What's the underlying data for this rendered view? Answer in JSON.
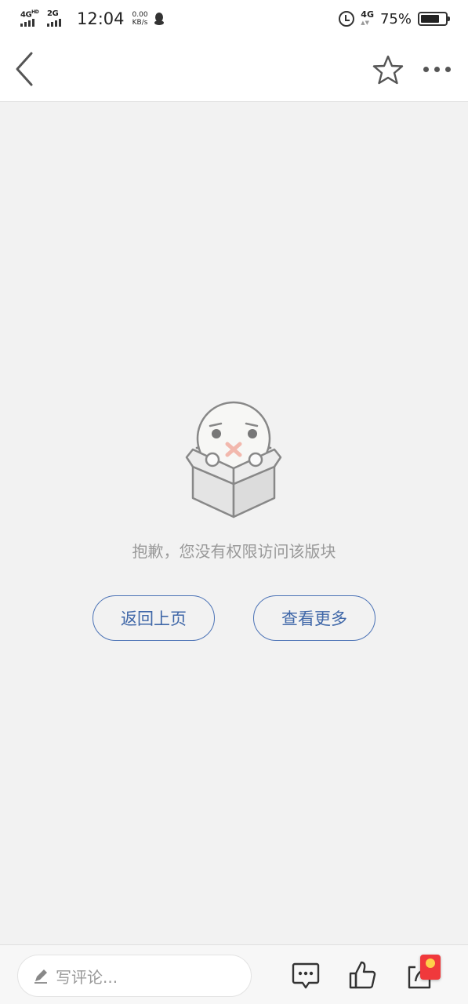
{
  "status_bar": {
    "sim1": "4G",
    "sim1_sup": "HD",
    "sim2": "2G",
    "time": "12:04",
    "speed_value": "0.00",
    "speed_unit": "KB/s",
    "network": "4G",
    "battery": "75%",
    "battery_level": 0.75,
    "icons": [
      "signal-icon",
      "qq-icon",
      "alarm-icon",
      "battery-icon"
    ]
  },
  "navbar": {
    "icons": [
      "back-arrow-icon",
      "star-icon",
      "more-dots-icon"
    ]
  },
  "main": {
    "message": "抱歉，您没有权限访问该版块",
    "back_button": "返回上页",
    "more_button": "查看更多",
    "illustration": "no-permission-box-icon"
  },
  "bottom_bar": {
    "comment_placeholder": "写评论...",
    "icons": [
      "pencil-icon",
      "comment-icon",
      "thumbs-up-icon",
      "share-icon",
      "red-packet-icon"
    ]
  },
  "colors": {
    "accent": "#4c73b6",
    "background": "#f2f2f2",
    "message_text": "#999999",
    "red_packet": "#f0393c"
  }
}
